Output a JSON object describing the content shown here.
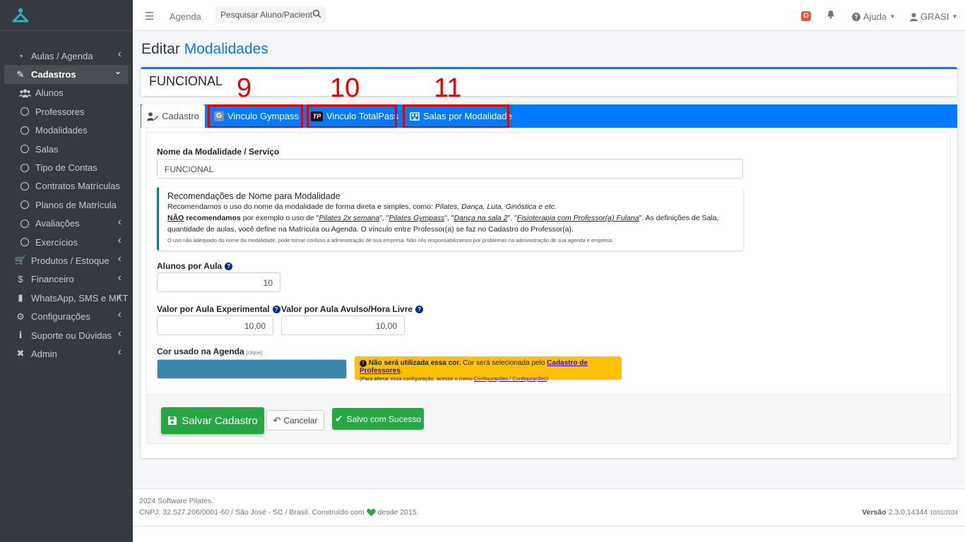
{
  "sidebar": {
    "items": [
      {
        "label": "Aulas / Agenda",
        "icon": "dashboard-icon",
        "arrow": "‹"
      },
      {
        "label": "Cadastros",
        "icon": "edit-icon",
        "arrow": "⌄",
        "active": true
      },
      {
        "label": "Alunos",
        "icon": "users-icon"
      },
      {
        "label": "Professores",
        "icon": "circle-icon"
      },
      {
        "label": "Modalidades",
        "icon": "circle-icon"
      },
      {
        "label": "Salas",
        "icon": "circle-icon"
      },
      {
        "label": "Tipo de Contas",
        "icon": "circle-icon"
      },
      {
        "label": "Contratos Matrículas",
        "icon": "circle-icon"
      },
      {
        "label": "Planos de Matrícula",
        "icon": "circle-icon"
      },
      {
        "label": "Avaliações",
        "icon": "circle-icon",
        "arrow": "‹"
      },
      {
        "label": "Exercícios",
        "icon": "circle-icon",
        "arrow": "‹"
      },
      {
        "label": "Produtos / Estoque",
        "icon": "cart-icon",
        "arrow": "‹"
      },
      {
        "label": "Financeiro",
        "icon": "dollar-icon",
        "arrow": "‹"
      },
      {
        "label": "WhatsApp, SMS e MKT",
        "icon": "phone-icon",
        "arrow": "‹"
      },
      {
        "label": "Configurações",
        "icon": "gear-icon",
        "arrow": "‹"
      },
      {
        "label": "Suporte ou Dúvidas",
        "icon": "info-icon",
        "arrow": "‹"
      },
      {
        "label": "Admin",
        "icon": "tools-icon",
        "arrow": "‹"
      }
    ]
  },
  "topbar": {
    "agenda": "Agenda",
    "search_placeholder": "Pesquisar Aluno/Pacient",
    "g_badge": "G",
    "help": "Ajuda",
    "user": "GRASI"
  },
  "page": {
    "title_prefix": "Editar",
    "title_highlight": "Modalidades",
    "record_name": "FUNCIONAL"
  },
  "annotations": [
    "9",
    "10",
    "11"
  ],
  "tabs": {
    "cadastro": "Cadastro",
    "gympass": "Vinculo Gympass",
    "totalpass": "Vinculo TotalPass",
    "salas": "Salas por Modalidade"
  },
  "form": {
    "name_label": "Nome da Modalidade / Serviço",
    "name_value": "FUNCIONAL",
    "callout_title": "Recomendações de Nome para Modalidade",
    "callout_line1_a": "Recomendamos o uso do nome da modalidade de forma direta e simples, como: ",
    "callout_line1_b": "Pilates, Dança, Luta, Ginóstica e etc.",
    "callout_nao": "NÃO",
    "callout_rec": " recomendamos",
    "callout_line2_a": " por exemplo o uso de \"",
    "callout_ex1": "Pilates 2x semana",
    "callout_sep1": "\", \"",
    "callout_ex2": "Pilates Gympass",
    "callout_sep2": "\", \"",
    "callout_ex3": "Dança na sala 2",
    "callout_sep3": "\", \"",
    "callout_ex4": "Fisioterapia com Professor(a) Fulana",
    "callout_line2_b": "\". As definições de Sala, quantidade de aulas, você define na Matrícula ou Agenda. O vínculo entre Professor(a) se faz no Cadastro do Professor(a).",
    "callout_small": "O uso não adequado do nome da modalidade, pode tornar confuso a administração de sua empresa. Não nós responsabilizamos por problemas na administração de sua agenda e empresa.",
    "alunos_label": "Alunos por Aula",
    "alunos_value": "10",
    "exp_label": "Valor por Aula Experimental",
    "exp_value": "10,00",
    "avulso_label": "Valor por Aula Avulso/Hora Livre",
    "avulso_value": "10,00",
    "cor_label": "Cor usado na Agenda",
    "cor_hint": "[clique]",
    "cor_value": "#3a87ad",
    "warn_bold": "Não será utilizada essa cor.",
    "warn_text": " Cor será selecionada pelo ",
    "warn_link": "Cadastro de Professores",
    "warn_end": ".",
    "warn_small": "(Para alterar essa configuração, acesse o menu ",
    "warn_small_link": "Configurações / Configurações",
    "warn_small_end": ")"
  },
  "buttons": {
    "save": "Salvar Cadastro",
    "cancel": "Cancelar",
    "success": "Salvo com Sucesso"
  },
  "footer": {
    "line1": "2024 Software Pilates.",
    "line2_a": "CNPJ: 32.527.206/0001-60 / São José - SC / Brasil. Construído com",
    "line2_b": "desde 2015.",
    "version_label": "Versão",
    "version": "2.3.0.14344",
    "version_date": "10/01/2024"
  }
}
